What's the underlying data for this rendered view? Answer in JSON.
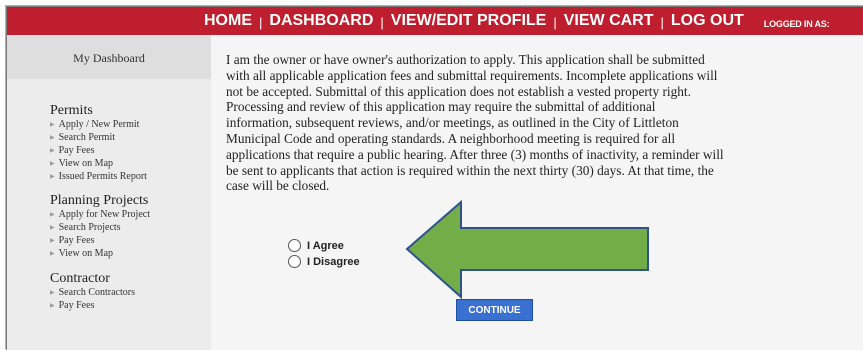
{
  "nav": {
    "home": "HOME",
    "dashboard": "DASHBOARD",
    "profile": "VIEW/EDIT PROFILE",
    "cart": "VIEW CART",
    "logout": "LOG OUT",
    "separator": "|",
    "logged_in": "LOGGED IN AS:"
  },
  "sidebar": {
    "dashboard_label": "My Dashboard",
    "permits": {
      "title": "Permits",
      "items": [
        "Apply / New Permit",
        "Search Permit",
        "Pay Fees",
        "View on Map",
        "Issued Permits Report"
      ]
    },
    "planning": {
      "title": "Planning Projects",
      "items": [
        "Apply for New Project",
        "Search Projects",
        "Pay Fees",
        "View on Map"
      ]
    },
    "contractor": {
      "title": "Contractor",
      "items": [
        "Search Contractors",
        "Pay Fees"
      ]
    }
  },
  "content": {
    "lines": [
      "I am the owner or have owner's authorization to apply. This application shall be submitted",
      "with all applicable application fees and submittal requirements. Incomplete applications will",
      "not be accepted. Submittal of this application does not establish a vested property right.",
      "Processing and review of this application may require the submittal of additional",
      "information, subsequent reviews, and/or meetings, as outlined in the City of Littleton",
      "Municipal Code and operating standards. A neighborhood meeting is required for all",
      "applications that require a public hearing. After three (3) months of inactivity, a reminder will",
      "be sent to applicants that action is required within the next thirty (30) days. At that time, the",
      "case will be closed."
    ],
    "agree_label": "I Agree",
    "disagree_label": "I Disagree",
    "continue_label": "CONTINUE"
  },
  "colors": {
    "nav_bar": "#be1e2d",
    "sidebar_bg": "#ececec",
    "content_bg": "#f5f5f5",
    "button": "#3a70d0",
    "arrow_fill": "#72ad47",
    "arrow_stroke": "#2f528f"
  },
  "icons": {
    "menu_bullet": "triangle-right-icon",
    "annotation": "left-arrow-icon"
  }
}
